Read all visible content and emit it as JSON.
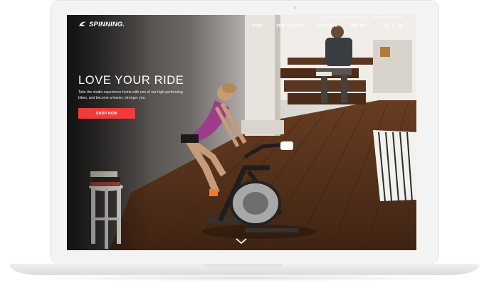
{
  "brand": {
    "name": "SPINNING."
  },
  "nav": {
    "utility": [
      "BECOME AN INSTRUCTOR",
      "LOGIN or SIGN UP"
    ],
    "menu": [
      "SHOP",
      "FIND A CLASS",
      "FOR PROS",
      "GET FIT"
    ]
  },
  "hero": {
    "title": "LOVE YOUR RIDE",
    "copy": "Take the studio experience home with one of our high-performing bikes, and become a leaner, stronger you.",
    "cta": "SHOP NOW"
  },
  "icons": [
    "spinning-logo-icon",
    "search-icon",
    "cart-icon",
    "chevron-down-icon"
  ],
  "colors": {
    "accent": "#ef3b3b",
    "nav_text": "#ffffff",
    "device": "#f3f3f4"
  }
}
